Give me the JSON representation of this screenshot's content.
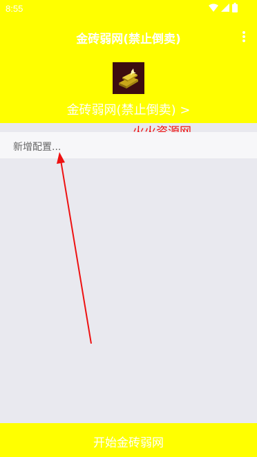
{
  "status_bar": {
    "time": "8:55",
    "icons": [
      "wifi-icon",
      "signal-icon",
      "battery-icon"
    ]
  },
  "app_bar": {
    "title": "金砖弱网(禁止倒卖)",
    "menu_icon": "more-vert-icon"
  },
  "app_info": {
    "icon": "gold-bar-icon",
    "subtitle": "金砖弱网(禁止倒卖) >"
  },
  "watermark": "火火资源网",
  "config_list": {
    "items": [
      {
        "label": "新增配置..."
      }
    ]
  },
  "bottom_action": {
    "label": "开始金砖弱网"
  },
  "colors": {
    "accent": "#ffff00",
    "background": "#e9e9ef",
    "annotation": "#ee1111"
  }
}
